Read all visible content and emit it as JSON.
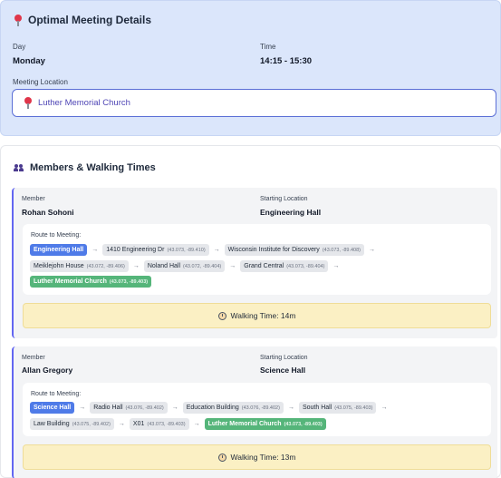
{
  "meeting": {
    "title": "Optimal Meeting Details",
    "day_label": "Day",
    "day_value": "Monday",
    "time_label": "Time",
    "time_value": "14:15 - 15:30",
    "location_label": "Meeting Location",
    "location_value": "Luther Memorial Church"
  },
  "members_section": {
    "title": "Members & Walking Times",
    "member_label": "Member",
    "start_label": "Starting Location",
    "route_label": "Route to Meeting:",
    "members": [
      {
        "name": "Rohan Sohoni",
        "start": "Engineering Hall",
        "walking_time": "Walking Time: 14m",
        "route_line1": [
          {
            "name": "Engineering Hall",
            "coord": "",
            "type": "start"
          },
          {
            "name": "1410 Engineering Dr",
            "coord": "(43.073, -89.410)",
            "type": "stop"
          },
          {
            "name": "Wisconsin Institute for Discovery",
            "coord": "(43.073, -89.408)",
            "type": "stop"
          }
        ],
        "route_line2": [
          {
            "name": "Meiklejohn House",
            "coord": "(43.072, -89.406)",
            "type": "stop"
          },
          {
            "name": "Noland Hall",
            "coord": "(43.072, -89.404)",
            "type": "stop"
          },
          {
            "name": "Grand Central",
            "coord": "(43.073, -89.404)",
            "type": "stop"
          }
        ],
        "route_line3": [
          {
            "name": "Luther Memorial Church",
            "coord": "(43.073, -89.403)",
            "type": "end"
          }
        ]
      },
      {
        "name": "Allan Gregory",
        "start": "Science Hall",
        "walking_time": "Walking Time: 13m",
        "route_line1": [
          {
            "name": "Science Hall",
            "coord": "",
            "type": "start"
          },
          {
            "name": "Radio Hall",
            "coord": "(43.076, -89.402)",
            "type": "stop"
          },
          {
            "name": "Education Building",
            "coord": "(43.076, -89.402)",
            "type": "stop"
          },
          {
            "name": "South Hall",
            "coord": "(43.075, -89.403)",
            "type": "stop"
          }
        ],
        "route_line2": [
          {
            "name": "Law Building",
            "coord": "(43.075, -89.402)",
            "type": "stop"
          },
          {
            "name": "X01",
            "coord": "(43.073, -89.403)",
            "type": "stop"
          },
          {
            "name": "Luther Memorial Church",
            "coord": "(43.073, -89.403)",
            "type": "end"
          }
        ]
      }
    ]
  },
  "icons": {
    "pin": "map-pin-icon",
    "people": "people-icon",
    "clock": "clock-icon"
  },
  "colors": {
    "header_bg": "#dbe6fb",
    "accent": "#6366f1",
    "start_chip": "#4f7be8",
    "end_chip": "#55b57a",
    "walking_bg": "#fbf0c4"
  }
}
